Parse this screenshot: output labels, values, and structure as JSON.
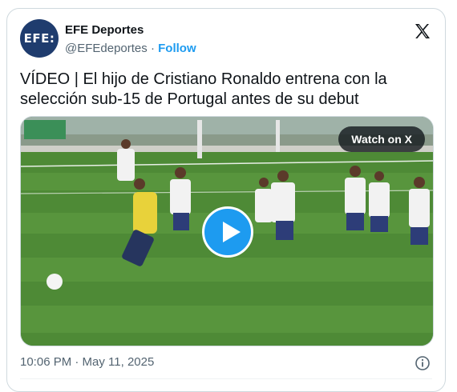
{
  "account": {
    "avatar_text": "EFE:",
    "name": "EFE Deportes",
    "handle": "@EFEdeportes",
    "separator": "·",
    "follow_label": "Follow"
  },
  "tweet": {
    "text": "VÍDEO | El hijo de Cristiano Ronaldo entrena con la selección sub-15 de Portugal antes de su debut",
    "timestamp": "10:06 PM · May 11, 2025"
  },
  "media": {
    "watch_label": "Watch on X",
    "type": "video"
  },
  "icons": {
    "brand": "x-logo-icon",
    "play": "play-icon",
    "info": "info-icon"
  },
  "colors": {
    "accent": "#1d9bf0",
    "text": "#0f1419",
    "secondary": "#536471",
    "avatar_bg": "#1f3c6e"
  }
}
